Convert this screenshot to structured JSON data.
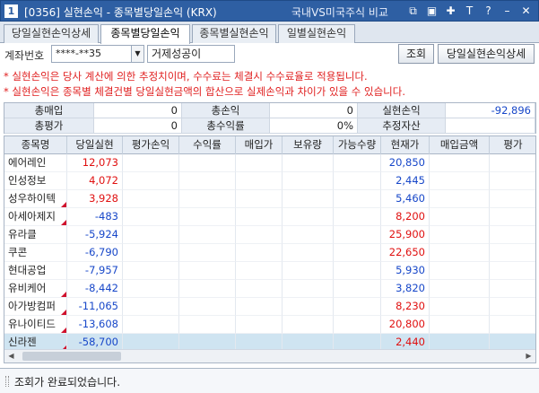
{
  "window": {
    "number": "1",
    "title": "[0356] 실현손익 - 종목별당일손익 (KRX)",
    "compare": "국내VS미국주식 비교",
    "icons": [
      "window-link-icon",
      "window-tile-icon",
      "pin-icon",
      "font-size-icon",
      "help-icon",
      "minimize-icon",
      "close-icon"
    ]
  },
  "tabs": [
    {
      "label": "당일실현손익상세",
      "active": false
    },
    {
      "label": "종목별당일손익",
      "active": true
    },
    {
      "label": "종목별실현손익",
      "active": false
    },
    {
      "label": "일별실현손익",
      "active": false
    }
  ],
  "account": {
    "label": "계좌번호",
    "number": "****-**35",
    "name": "거제성공이"
  },
  "buttons": {
    "query": "조회",
    "detail": "당일실현손익상세"
  },
  "notices": [
    "* 실현손익은 당사 계산에 의한 추정치이며, 수수료는 체결시 수수료율로 적용됩니다.",
    "* 실현손익은 종목별 체결건별 당일실현금액의 합산으로 실제손익과 차이가 있을 수 있습니다."
  ],
  "summary": {
    "total_buy_label": "총매입",
    "total_buy": "0",
    "total_pl_label": "총손익",
    "total_pl": "0",
    "realized_label": "실현손익",
    "realized": "-92,896",
    "total_eval_label": "총평가",
    "total_eval": "0",
    "total_rate_label": "총수익률",
    "total_rate": "0%",
    "est_asset_label": "추정자산",
    "est_asset": ""
  },
  "columns": [
    "종목명",
    "당일실현",
    "평가손익",
    "수익률",
    "매입가",
    "보유량",
    "가능수량",
    "현재가",
    "매입금액",
    "평가"
  ],
  "rows": [
    {
      "name": "에어레인",
      "realized": "12,073",
      "sign": "pos",
      "price": "20,850",
      "price_sign": "neg",
      "flag": false
    },
    {
      "name": "인성정보",
      "realized": "4,072",
      "sign": "pos",
      "price": "2,445",
      "price_sign": "neg",
      "flag": false
    },
    {
      "name": "성우하이텍",
      "realized": "3,928",
      "sign": "pos",
      "price": "5,460",
      "price_sign": "neg",
      "flag": true
    },
    {
      "name": "아세아제지",
      "realized": "-483",
      "sign": "neg",
      "price": "8,200",
      "price_sign": "pos",
      "flag": true
    },
    {
      "name": "유라클",
      "realized": "-5,924",
      "sign": "neg",
      "price": "25,900",
      "price_sign": "pos",
      "flag": false
    },
    {
      "name": "쿠콘",
      "realized": "-6,790",
      "sign": "neg",
      "price": "22,650",
      "price_sign": "pos",
      "flag": false
    },
    {
      "name": "현대공업",
      "realized": "-7,957",
      "sign": "neg",
      "price": "5,930",
      "price_sign": "neg",
      "flag": false
    },
    {
      "name": "유비케어",
      "realized": "-8,442",
      "sign": "neg",
      "price": "3,820",
      "price_sign": "neg",
      "flag": true
    },
    {
      "name": "아가방컴퍼",
      "realized": "-11,065",
      "sign": "neg",
      "price": "8,230",
      "price_sign": "pos",
      "flag": true
    },
    {
      "name": "유나이티드",
      "realized": "-13,608",
      "sign": "neg",
      "price": "20,800",
      "price_sign": "pos",
      "flag": true
    },
    {
      "name": "신라젠",
      "realized": "-58,700",
      "sign": "neg",
      "price": "2,440",
      "price_sign": "pos",
      "flag": true,
      "selected": true
    }
  ],
  "status": {
    "message": "조회가 완료되었습니다."
  },
  "colors": {
    "titlebar": "#2e5fa3",
    "positive": "#e01010",
    "negative": "#1747c9",
    "notice": "#e02020",
    "selected_row": "#cfe4f1"
  }
}
